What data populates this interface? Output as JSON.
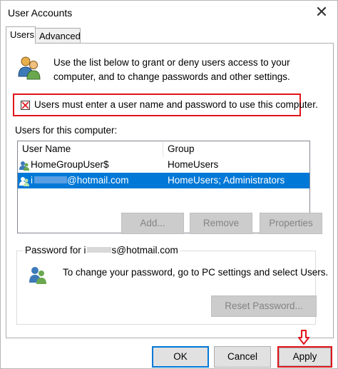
{
  "window": {
    "title": "User Accounts",
    "close_glyph": "✕"
  },
  "tabs": [
    {
      "label": "Users"
    },
    {
      "label": "Advanced"
    }
  ],
  "intro": {
    "icon": "users-group-icon",
    "text": "Use the list below to grant or deny users access to your computer, and to change passwords and other settings."
  },
  "checkbox": {
    "label": "Users must enter a user name and password to use this computer.",
    "state": "unchecked-marked"
  },
  "users_label": "Users for this computer:",
  "list": {
    "columns": [
      "User Name",
      "Group"
    ],
    "rows": [
      {
        "name": "HomeGroupUser$",
        "group": "HomeUsers",
        "selected": false
      },
      {
        "name_prefix": "i",
        "name_suffix": "@hotmail.com",
        "group": "HomeUsers; Administrators",
        "selected": true
      }
    ]
  },
  "buttons": {
    "add": "Add...",
    "remove": "Remove",
    "properties": "Properties"
  },
  "password_group": {
    "title_prefix": "Password for i",
    "title_suffix": "s@hotmail.com",
    "text": "To change your password, go to PC settings and select Users.",
    "reset_label": "Reset Password..."
  },
  "footer": {
    "ok": "OK",
    "cancel": "Cancel",
    "apply": "Apply"
  },
  "colors": {
    "highlight": "#0078d7",
    "annotation": "#e0151b"
  }
}
